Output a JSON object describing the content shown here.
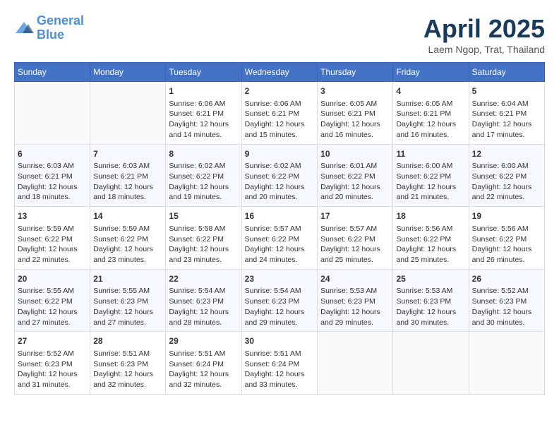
{
  "header": {
    "logo_line1": "General",
    "logo_line2": "Blue",
    "month_title": "April 2025",
    "subtitle": "Laem Ngop, Trat, Thailand"
  },
  "days_of_week": [
    "Sunday",
    "Monday",
    "Tuesday",
    "Wednesday",
    "Thursday",
    "Friday",
    "Saturday"
  ],
  "weeks": [
    [
      {
        "day": "",
        "data": ""
      },
      {
        "day": "",
        "data": ""
      },
      {
        "day": "1",
        "data": "Sunrise: 6:06 AM\nSunset: 6:21 PM\nDaylight: 12 hours and 14 minutes."
      },
      {
        "day": "2",
        "data": "Sunrise: 6:06 AM\nSunset: 6:21 PM\nDaylight: 12 hours and 15 minutes."
      },
      {
        "day": "3",
        "data": "Sunrise: 6:05 AM\nSunset: 6:21 PM\nDaylight: 12 hours and 16 minutes."
      },
      {
        "day": "4",
        "data": "Sunrise: 6:05 AM\nSunset: 6:21 PM\nDaylight: 12 hours and 16 minutes."
      },
      {
        "day": "5",
        "data": "Sunrise: 6:04 AM\nSunset: 6:21 PM\nDaylight: 12 hours and 17 minutes."
      }
    ],
    [
      {
        "day": "6",
        "data": "Sunrise: 6:03 AM\nSunset: 6:21 PM\nDaylight: 12 hours and 18 minutes."
      },
      {
        "day": "7",
        "data": "Sunrise: 6:03 AM\nSunset: 6:21 PM\nDaylight: 12 hours and 18 minutes."
      },
      {
        "day": "8",
        "data": "Sunrise: 6:02 AM\nSunset: 6:22 PM\nDaylight: 12 hours and 19 minutes."
      },
      {
        "day": "9",
        "data": "Sunrise: 6:02 AM\nSunset: 6:22 PM\nDaylight: 12 hours and 20 minutes."
      },
      {
        "day": "10",
        "data": "Sunrise: 6:01 AM\nSunset: 6:22 PM\nDaylight: 12 hours and 20 minutes."
      },
      {
        "day": "11",
        "data": "Sunrise: 6:00 AM\nSunset: 6:22 PM\nDaylight: 12 hours and 21 minutes."
      },
      {
        "day": "12",
        "data": "Sunrise: 6:00 AM\nSunset: 6:22 PM\nDaylight: 12 hours and 22 minutes."
      }
    ],
    [
      {
        "day": "13",
        "data": "Sunrise: 5:59 AM\nSunset: 6:22 PM\nDaylight: 12 hours and 22 minutes."
      },
      {
        "day": "14",
        "data": "Sunrise: 5:59 AM\nSunset: 6:22 PM\nDaylight: 12 hours and 23 minutes."
      },
      {
        "day": "15",
        "data": "Sunrise: 5:58 AM\nSunset: 6:22 PM\nDaylight: 12 hours and 23 minutes."
      },
      {
        "day": "16",
        "data": "Sunrise: 5:57 AM\nSunset: 6:22 PM\nDaylight: 12 hours and 24 minutes."
      },
      {
        "day": "17",
        "data": "Sunrise: 5:57 AM\nSunset: 6:22 PM\nDaylight: 12 hours and 25 minutes."
      },
      {
        "day": "18",
        "data": "Sunrise: 5:56 AM\nSunset: 6:22 PM\nDaylight: 12 hours and 25 minutes."
      },
      {
        "day": "19",
        "data": "Sunrise: 5:56 AM\nSunset: 6:22 PM\nDaylight: 12 hours and 26 minutes."
      }
    ],
    [
      {
        "day": "20",
        "data": "Sunrise: 5:55 AM\nSunset: 6:22 PM\nDaylight: 12 hours and 27 minutes."
      },
      {
        "day": "21",
        "data": "Sunrise: 5:55 AM\nSunset: 6:23 PM\nDaylight: 12 hours and 27 minutes."
      },
      {
        "day": "22",
        "data": "Sunrise: 5:54 AM\nSunset: 6:23 PM\nDaylight: 12 hours and 28 minutes."
      },
      {
        "day": "23",
        "data": "Sunrise: 5:54 AM\nSunset: 6:23 PM\nDaylight: 12 hours and 29 minutes."
      },
      {
        "day": "24",
        "data": "Sunrise: 5:53 AM\nSunset: 6:23 PM\nDaylight: 12 hours and 29 minutes."
      },
      {
        "day": "25",
        "data": "Sunrise: 5:53 AM\nSunset: 6:23 PM\nDaylight: 12 hours and 30 minutes."
      },
      {
        "day": "26",
        "data": "Sunrise: 5:52 AM\nSunset: 6:23 PM\nDaylight: 12 hours and 30 minutes."
      }
    ],
    [
      {
        "day": "27",
        "data": "Sunrise: 5:52 AM\nSunset: 6:23 PM\nDaylight: 12 hours and 31 minutes."
      },
      {
        "day": "28",
        "data": "Sunrise: 5:51 AM\nSunset: 6:23 PM\nDaylight: 12 hours and 32 minutes."
      },
      {
        "day": "29",
        "data": "Sunrise: 5:51 AM\nSunset: 6:24 PM\nDaylight: 12 hours and 32 minutes."
      },
      {
        "day": "30",
        "data": "Sunrise: 5:51 AM\nSunset: 6:24 PM\nDaylight: 12 hours and 33 minutes."
      },
      {
        "day": "",
        "data": ""
      },
      {
        "day": "",
        "data": ""
      },
      {
        "day": "",
        "data": ""
      }
    ]
  ]
}
